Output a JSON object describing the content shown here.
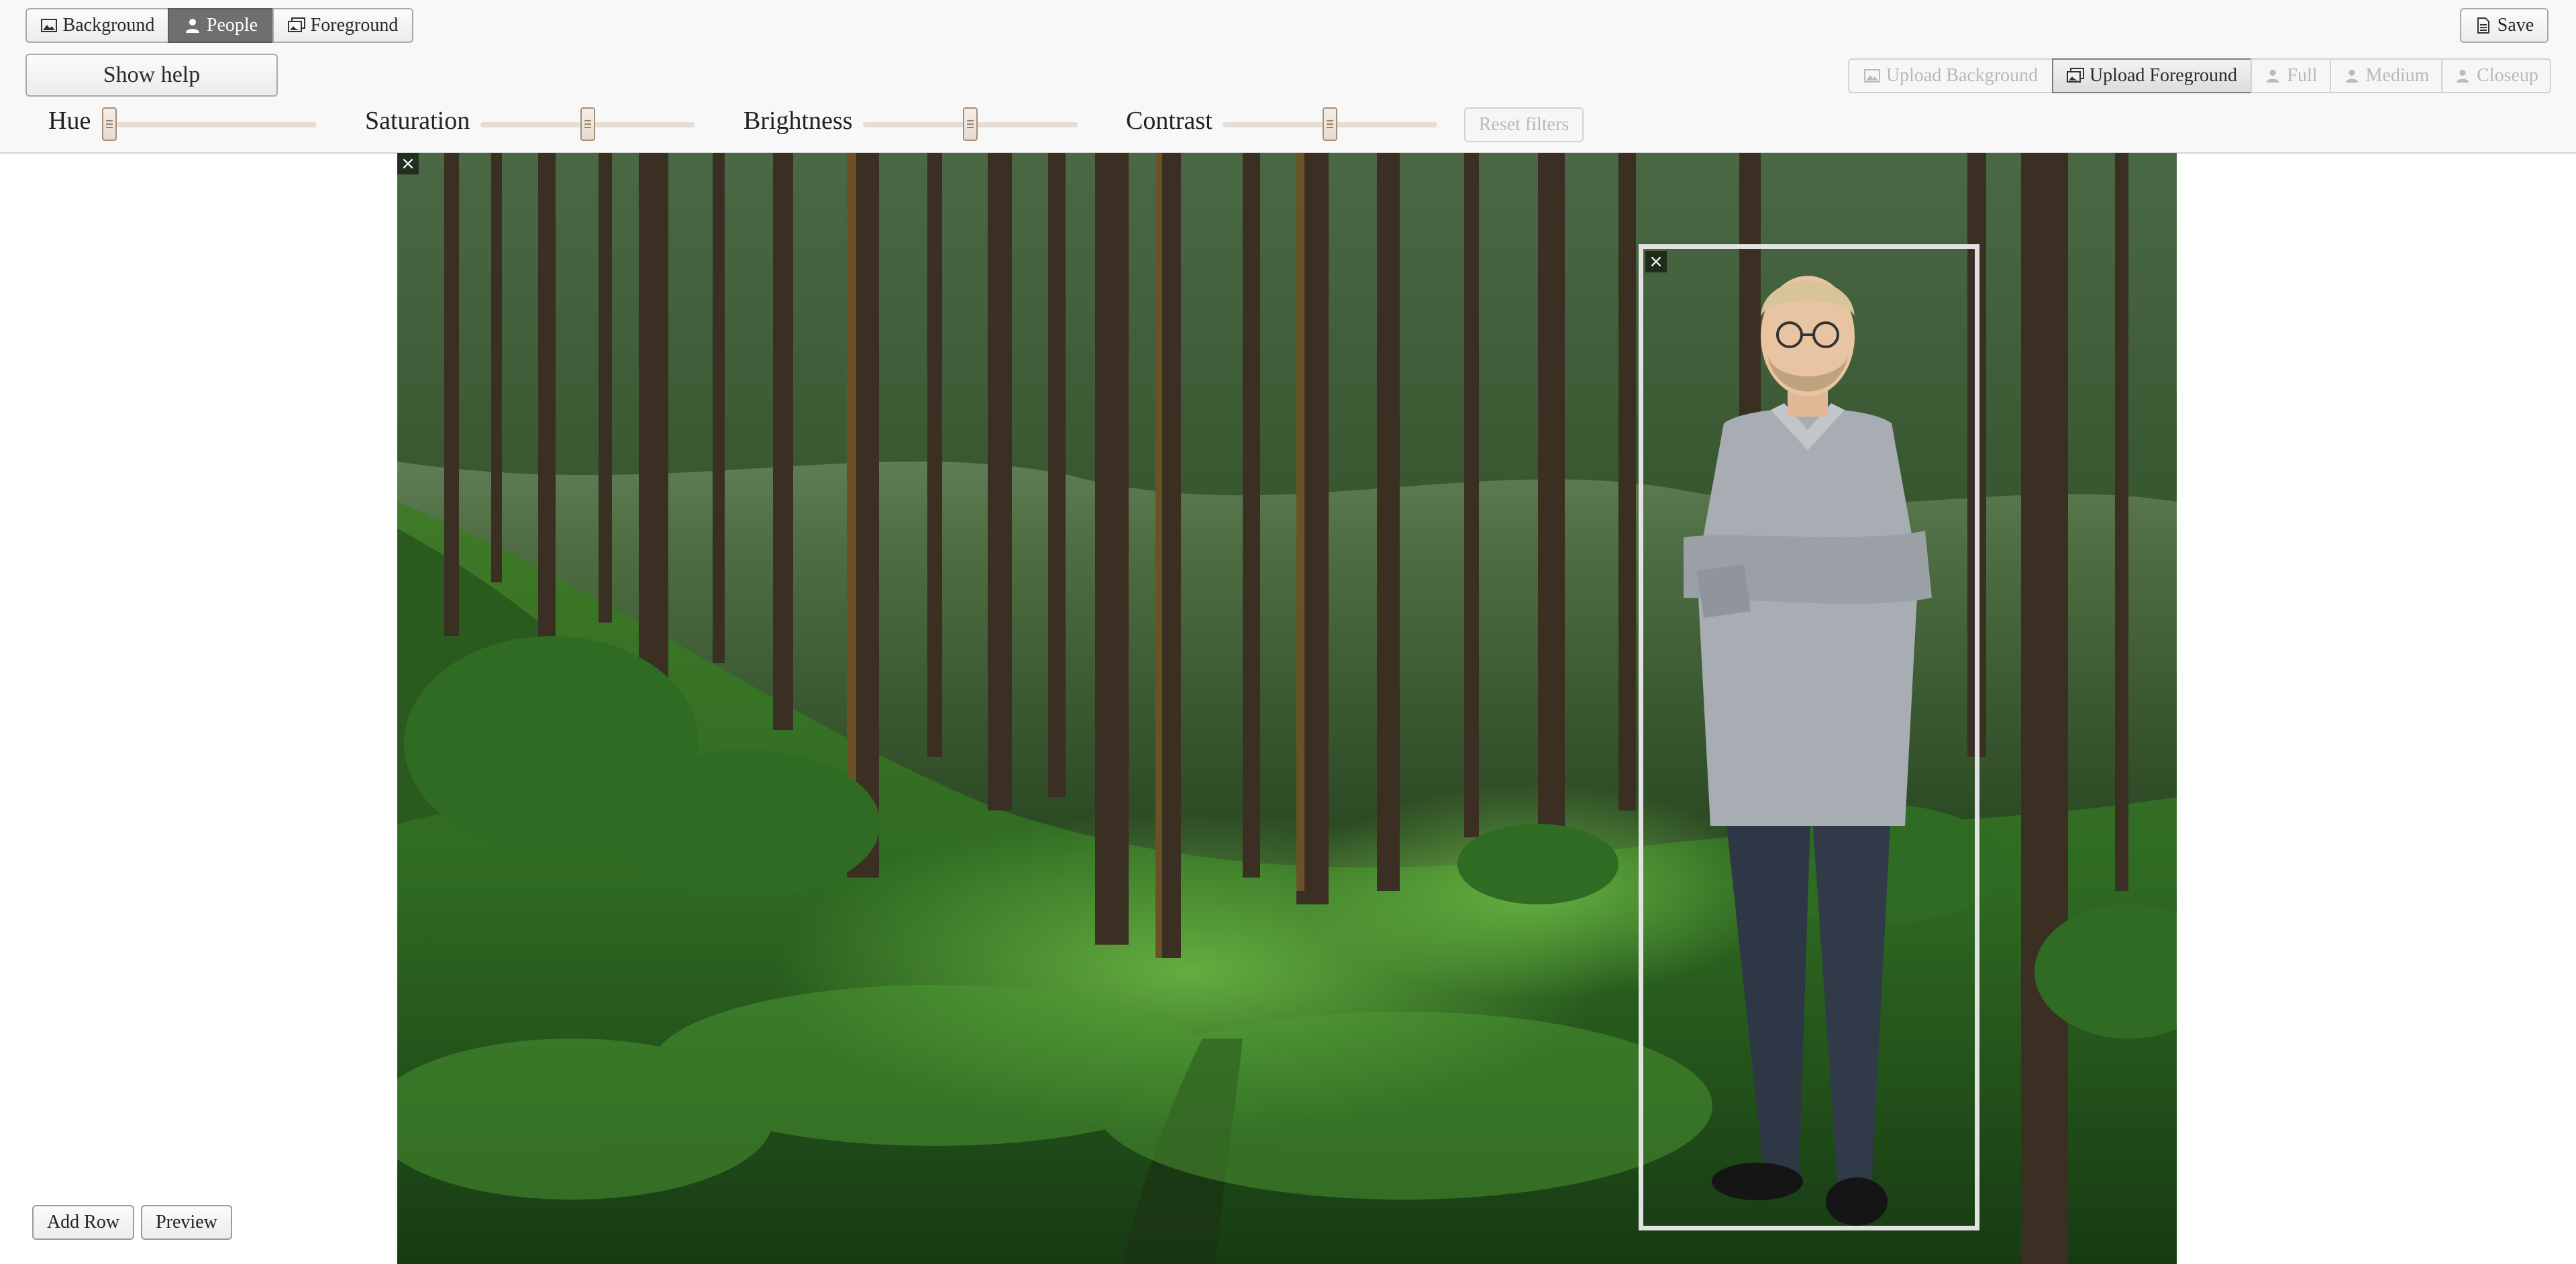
{
  "tabs": [
    {
      "label": "Background",
      "icon": "image-icon",
      "active": false
    },
    {
      "label": "People",
      "icon": "person-icon",
      "active": true
    },
    {
      "label": "Foreground",
      "icon": "images-icon",
      "active": false
    }
  ],
  "save_label": "Save",
  "show_help_label": "Show help",
  "upload": {
    "background_label": "Upload Background",
    "foreground_label": "Upload Foreground"
  },
  "framing": [
    {
      "label": "Full",
      "icon": "person-icon"
    },
    {
      "label": "Medium",
      "icon": "person-icon"
    },
    {
      "label": "Closeup",
      "icon": "person-icon"
    }
  ],
  "filters": {
    "hue_label": "Hue",
    "saturation_label": "Saturation",
    "brightness_label": "Brightness",
    "contrast_label": "Contrast",
    "hue_value": 0.0,
    "saturation_value": 0.5,
    "brightness_value": 0.5,
    "contrast_value": 0.5,
    "reset_label": "Reset filters"
  },
  "canvas": {
    "background_close_glyph": "×",
    "person_close_glyph": "×"
  },
  "footer": {
    "add_row_label": "Add Row",
    "preview_label": "Preview"
  },
  "colors": {
    "active_tab": "#6f6f6f",
    "selection_frame": "#e2e2e2"
  }
}
